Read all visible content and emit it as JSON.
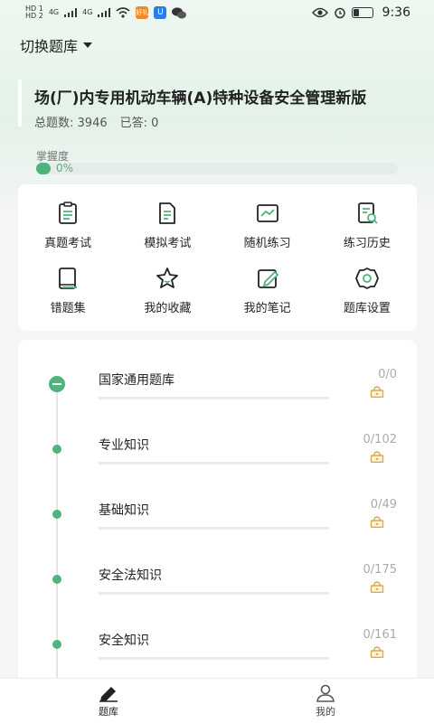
{
  "status_bar": {
    "sim1": "HD 1",
    "sim2": "HD 2",
    "net1": "4G",
    "net2": "4G",
    "app_badge": "好礼",
    "app_badge2": "U",
    "battery_level": 0.3,
    "time": "9:36"
  },
  "header": {
    "switch_label": "切换题库"
  },
  "bank": {
    "title": "场(厂)内专用机动车辆(A)特种设备安全管理新版",
    "total_label": "总题数:",
    "total_value": "3946",
    "answered_label": "已答:",
    "answered_value": "0"
  },
  "mastery": {
    "label": "掌握度",
    "percent_text": "0%",
    "percent": 0
  },
  "functions": [
    {
      "label": "真题考试",
      "icon": "clipboard-icon"
    },
    {
      "label": "模拟考试",
      "icon": "document-icon"
    },
    {
      "label": "随机练习",
      "icon": "chart-icon"
    },
    {
      "label": "练习历史",
      "icon": "history-search-icon"
    },
    {
      "label": "错题集",
      "icon": "book-icon"
    },
    {
      "label": "我的收藏",
      "icon": "star-icon"
    },
    {
      "label": "我的笔记",
      "icon": "note-edit-icon"
    },
    {
      "label": "题库设置",
      "icon": "settings-icon"
    }
  ],
  "chapters": [
    {
      "name": "国家通用题库",
      "count": "0/0"
    },
    {
      "name": "专业知识",
      "count": "0/102"
    },
    {
      "name": "基础知识",
      "count": "0/49"
    },
    {
      "name": "安全法知识",
      "count": "0/175"
    },
    {
      "name": "安全知识",
      "count": "0/161"
    }
  ],
  "tabs": [
    {
      "label": "题库",
      "icon": "pencil-icon",
      "active": true
    },
    {
      "label": "我的",
      "icon": "user-icon",
      "active": false
    }
  ],
  "colors": {
    "accent": "#4fb37b",
    "lock": "#d9a94a"
  }
}
